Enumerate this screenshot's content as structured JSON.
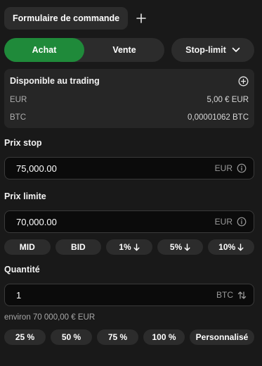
{
  "header": {
    "tab_label": "Formulaire de commande"
  },
  "side": {
    "buy_label": "Achat",
    "sell_label": "Vente",
    "order_type": "Stop-limit"
  },
  "balance": {
    "title": "Disponible au trading",
    "rows": [
      {
        "currency": "EUR",
        "amount": "5,00 € EUR"
      },
      {
        "currency": "BTC",
        "amount": "0,00001062 BTC"
      }
    ]
  },
  "stop_price": {
    "label": "Prix stop",
    "value": "75,000.00",
    "currency": "EUR"
  },
  "limit_price": {
    "label": "Prix limite",
    "value": "70,000.00",
    "currency": "EUR"
  },
  "price_chips": [
    "MID",
    "BID",
    "1%",
    "5%",
    "10%"
  ],
  "quantity": {
    "label": "Quantité",
    "value": "1",
    "currency": "BTC"
  },
  "estimate": "environ  70 000,00 € EUR",
  "quantity_chips": [
    "25 %",
    "50 %",
    "75 %",
    "100 %",
    "Personnalisé"
  ],
  "colors": {
    "accent_buy": "#1f8a3a",
    "background": "#191919"
  }
}
